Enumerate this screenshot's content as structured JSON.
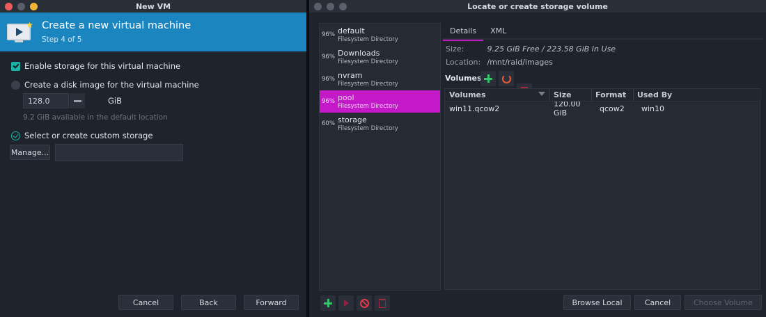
{
  "left_window": {
    "title": "New VM",
    "header": {
      "title": "Create a new virtual machine",
      "step": "Step 4 of 5"
    },
    "enable_storage": {
      "label": "Enable storage for this virtual machine",
      "checked": true
    },
    "create_disk": {
      "label": "Create a disk image for the virtual machine",
      "selected": false,
      "size_value": "128.0",
      "unit": "GiB",
      "hint": "9.2 GiB available in the default location"
    },
    "custom_storage": {
      "label": "Select or create custom storage",
      "selected": true,
      "manage_label": "Manage...",
      "path_value": ""
    },
    "buttons": {
      "cancel": "Cancel",
      "back": "Back",
      "forward": "Forward"
    }
  },
  "right_window": {
    "title": "Locate or create storage volume",
    "pools": [
      {
        "pct": "96%",
        "name": "default",
        "type": "Filesystem Directory"
      },
      {
        "pct": "96%",
        "name": "Downloads",
        "type": "Filesystem Directory"
      },
      {
        "pct": "96%",
        "name": "nvram",
        "type": "Filesystem Directory"
      },
      {
        "pct": "96%",
        "name": "pool",
        "type": "Filesystem Directory",
        "selected": true
      },
      {
        "pct": "60%",
        "name": "storage",
        "type": "Filesystem Directory"
      }
    ],
    "tabs": {
      "details": "Details",
      "xml": "XML"
    },
    "details": {
      "size_label": "Size:",
      "size_value": "9.25 GiB Free / 223.58 GiB In Use",
      "location_label": "Location:",
      "location_value": "/mnt/raid/images",
      "volumes_label": "Volumes"
    },
    "table": {
      "headers": [
        "Volumes",
        "Size",
        "Format",
        "Used By"
      ],
      "rows": [
        {
          "volume": "win11.qcow2",
          "size": "120.00 GiB",
          "format": "qcow2",
          "used_by": "win10"
        }
      ]
    },
    "buttons": {
      "browse_local": "Browse Local",
      "cancel": "Cancel",
      "choose_volume": "Choose Volume"
    }
  },
  "colors": {
    "header_blue": "#1b85c0",
    "accent_magenta": "#c419c9",
    "check_teal": "#1bb3a6",
    "add_green": "#35c46c"
  }
}
